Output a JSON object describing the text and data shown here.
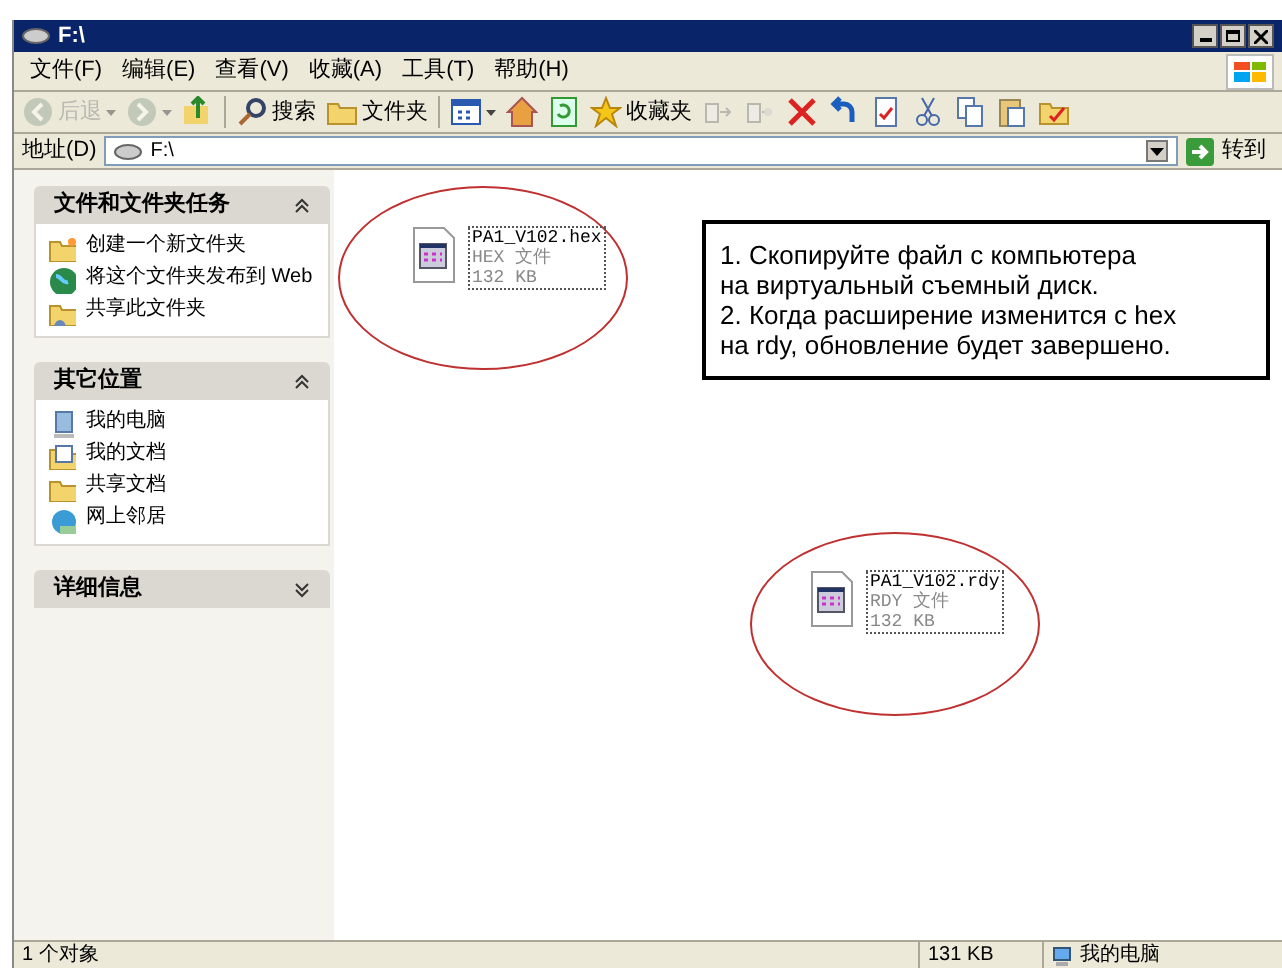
{
  "window": {
    "title": "F:\\"
  },
  "menu": [
    {
      "label": "文件(F)"
    },
    {
      "label": "编辑(E)"
    },
    {
      "label": "查看(V)"
    },
    {
      "label": "收藏(A)"
    },
    {
      "label": "工具(T)"
    },
    {
      "label": "帮助(H)"
    }
  ],
  "toolbar": [
    {
      "kind": "back",
      "label": "后退",
      "disabled": true
    },
    {
      "kind": "forward",
      "disabled": true
    },
    {
      "kind": "up"
    },
    {
      "kind": "sep"
    },
    {
      "kind": "search",
      "label": "搜索"
    },
    {
      "kind": "folders",
      "label": "文件夹"
    },
    {
      "kind": "sep"
    },
    {
      "kind": "views"
    },
    {
      "kind": "home"
    },
    {
      "kind": "refresh"
    },
    {
      "kind": "favorites",
      "label": "收藏夹"
    },
    {
      "kind": "moveto",
      "disabled": true
    },
    {
      "kind": "copyto",
      "disabled": true
    },
    {
      "kind": "delete"
    },
    {
      "kind": "undo"
    },
    {
      "kind": "properties"
    },
    {
      "kind": "cut"
    },
    {
      "kind": "copy"
    },
    {
      "kind": "paste"
    },
    {
      "kind": "note"
    }
  ],
  "address": {
    "label": "地址(D)",
    "value": "F:\\",
    "go": "转到"
  },
  "sidebar": [
    {
      "title": "文件和文件夹任务",
      "expanded": true,
      "items": [
        {
          "kind": "newfolder",
          "label": "创建一个新文件夹"
        },
        {
          "kind": "web",
          "label": "将这个文件夹发布到 Web"
        },
        {
          "kind": "share",
          "label": "共享此文件夹"
        }
      ]
    },
    {
      "title": "其它位置",
      "expanded": true,
      "items": [
        {
          "kind": "computer",
          "label": "我的电脑"
        },
        {
          "kind": "documents",
          "label": "我的文档"
        },
        {
          "kind": "folder",
          "label": "共享文档"
        },
        {
          "kind": "network",
          "label": "网上邻居"
        }
      ]
    },
    {
      "title": "详细信息",
      "expanded": false
    }
  ],
  "files": [
    {
      "name": "PA1_V102.hex",
      "type": "HEX 文件",
      "size": "132 KB"
    },
    {
      "name": "PA1_V102.rdy",
      "type": "RDY 文件",
      "size": "132 KB"
    }
  ],
  "annotation": [
    "1. Скопируйте файл с компьютера",
    "на виртуальный съемный диск.",
    "2. Когда расширение изменится с hex",
    "на rdy, обновление будет завершено."
  ],
  "status_bar": {
    "objects": "1 个对象",
    "size": "131 KB",
    "location": "我的电脑"
  }
}
